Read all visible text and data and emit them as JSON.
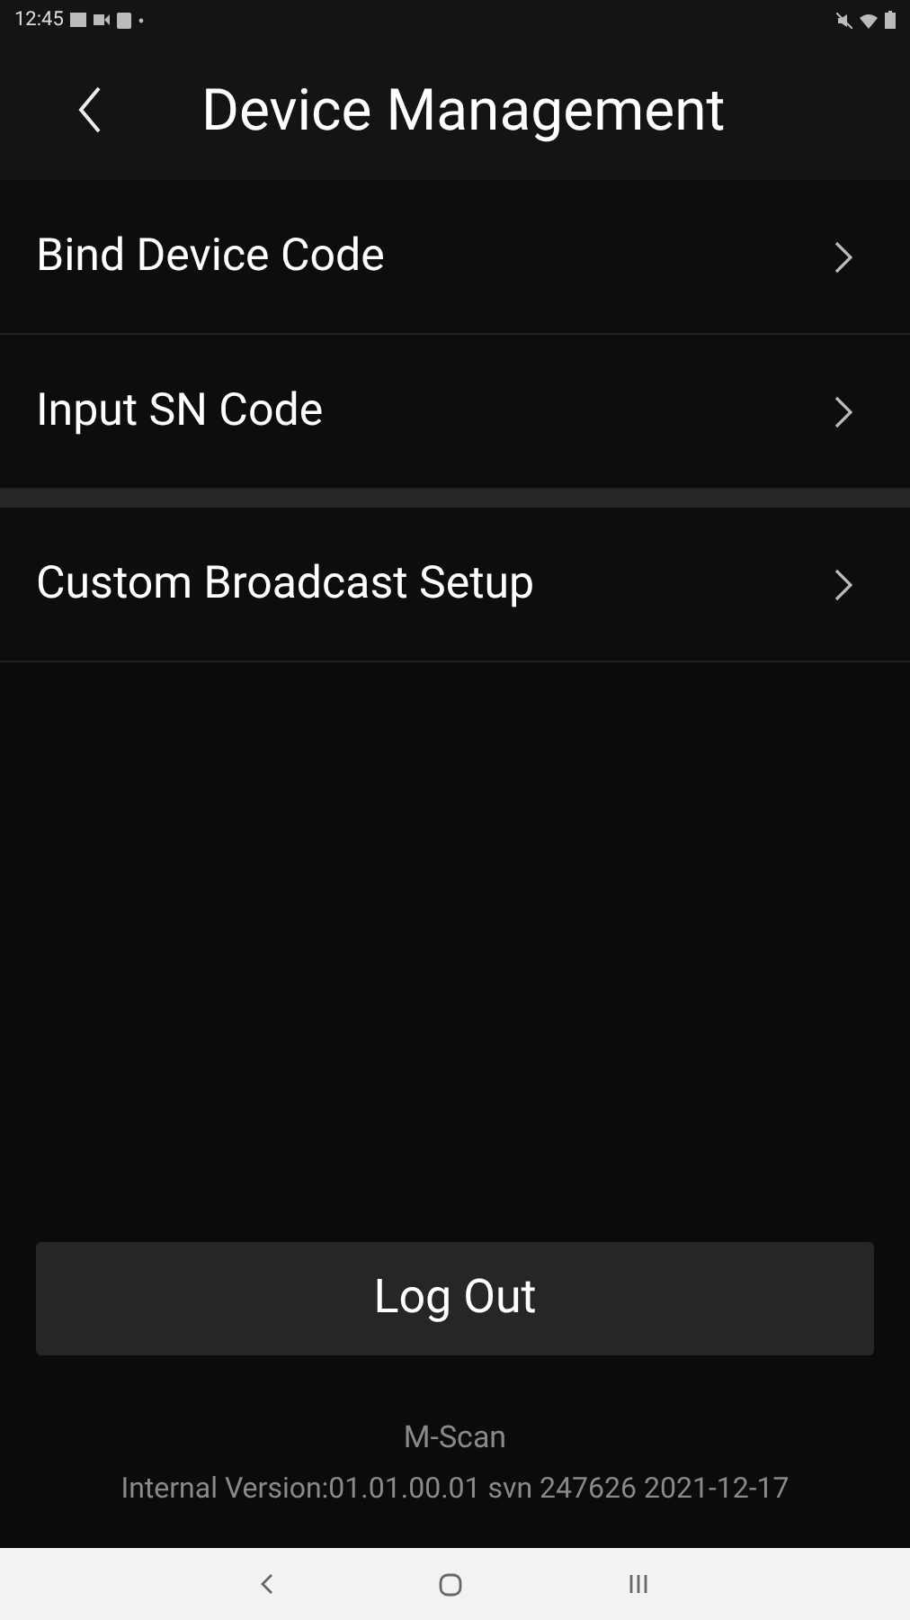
{
  "status_bar": {
    "time": "12:45"
  },
  "header": {
    "title": "Device Management"
  },
  "menu_groups": [
    {
      "items": [
        {
          "label": "Bind Device Code"
        },
        {
          "label": "Input SN Code"
        }
      ]
    },
    {
      "items": [
        {
          "label": "Custom Broadcast Setup"
        }
      ]
    }
  ],
  "logout_button": {
    "label": "Log Out"
  },
  "footer": {
    "app_name": "M-Scan",
    "version": "Internal Version:01.01.00.01 svn 247626 2021-12-17"
  }
}
